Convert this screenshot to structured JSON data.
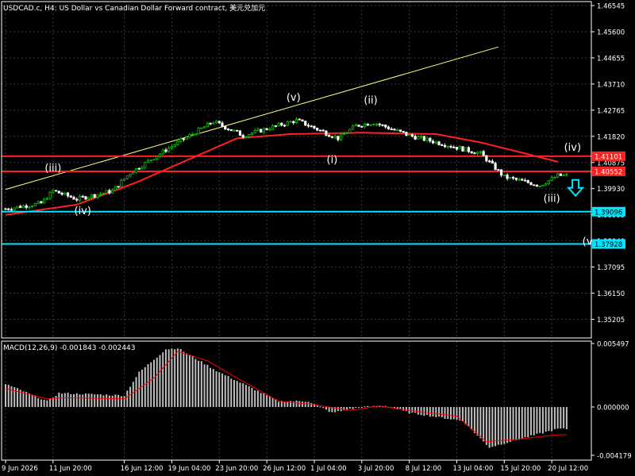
{
  "header": {
    "symbol": "USDCAD.c,",
    "timeframe": "H4:",
    "description": "US Dollar vs Canadian Dollar Forward contract,",
    "description_cn": "美元兑加元"
  },
  "macd": {
    "label": "MACD(12,26,9)",
    "main_value": "-0.001843",
    "signal_value": "-0.002443"
  },
  "colors": {
    "background": "#000000",
    "grid": "#3a3a3a",
    "bull_candle": "#00c800",
    "bear_candle": "#ffffff",
    "moving_average": "#ff2020",
    "trendline": "#ffff80",
    "resistance_line": "#ff2020",
    "support_line": "#00e5ff",
    "price_tag_red": "#ff2020",
    "price_tag_cyan": "#00e5ff",
    "histogram": "#c0c0c0",
    "signal_line": "#ff0000",
    "arrow": "#00e5ff"
  },
  "chart_data": [
    {
      "type": "candlestick",
      "title": "USDCAD.c, H4: US Dollar vs Canadian Dollar Forward contract",
      "y_ticks": [
        "1.46545",
        "1.45600",
        "1.44655",
        "1.43710",
        "1.42765",
        "1.41820",
        "1.40875",
        "1.39930",
        "1.38985",
        "1.38040",
        "1.37095",
        "1.36150",
        "1.35205"
      ],
      "ylim": [
        1.3453,
        1.4669
      ],
      "x_ticks": [
        "9 Jun 2026",
        "11 Jun 20:00",
        "16 Jun 12:00",
        "19 Jun 04:00",
        "23 Jun 20:00",
        "26 Jun 12:00",
        "1 Jul 04:00",
        "3 Jul 20:00",
        "8 Jul 12:00",
        "13 Jul 04:00",
        "15 Jul 20:00",
        "20 Jul 12:00"
      ],
      "x_tick_bars": [
        0,
        16,
        40,
        56,
        72,
        88,
        104,
        120,
        136,
        152,
        168,
        184
      ],
      "bar_count": 190,
      "price_path": [
        [
          0,
          1.392
        ],
        [
          12,
          1.394
        ],
        [
          16,
          1.3985
        ],
        [
          24,
          1.3955
        ],
        [
          36,
          1.3985
        ],
        [
          42,
          1.405
        ],
        [
          55,
          1.414
        ],
        [
          70,
          1.4235
        ],
        [
          80,
          1.4185
        ],
        [
          98,
          1.424
        ],
        [
          112,
          1.4175
        ],
        [
          118,
          1.422
        ],
        [
          124,
          1.4232
        ],
        [
          136,
          1.4185
        ],
        [
          160,
          1.412
        ],
        [
          168,
          1.4035
        ],
        [
          180,
          1.4005
        ],
        [
          186,
          1.404
        ]
      ],
      "moving_average": [
        [
          0,
          1.3898
        ],
        [
          24,
          1.3935
        ],
        [
          44,
          1.4015
        ],
        [
          78,
          1.4175
        ],
        [
          96,
          1.419
        ],
        [
          120,
          1.4195
        ],
        [
          145,
          1.419
        ],
        [
          160,
          1.416
        ],
        [
          175,
          1.412
        ],
        [
          186,
          1.409
        ]
      ],
      "trendline": {
        "from": [
          0,
          1.399
        ],
        "to": [
          166,
          1.4505
        ]
      },
      "horizontal_levels": [
        {
          "price": 1.41101,
          "label": "1.41101",
          "kind": "resistance"
        },
        {
          "price": 1.40552,
          "label": "1.40552",
          "kind": "resistance"
        },
        {
          "price": 1.39096,
          "label": "1.39096",
          "kind": "support"
        },
        {
          "price": 1.37928,
          "label": "1.37928",
          "kind": "support"
        }
      ],
      "wave_labels": [
        {
          "text": "(iii)",
          "bar": 16,
          "price": 1.4055
        },
        {
          "text": "(iv)",
          "bar": 26,
          "price": 1.39
        },
        {
          "text": "(v)",
          "bar": 97,
          "price": 1.431
        },
        {
          "text": "(i)",
          "bar": 110,
          "price": 1.4085
        },
        {
          "text": "(ii)",
          "bar": 123,
          "price": 1.43
        },
        {
          "text": "(iv)",
          "bar": 191,
          "price": 1.413
        },
        {
          "text": "(iii)",
          "bar": 184,
          "price": 1.3945
        },
        {
          "text": "(v",
          "bar": 196,
          "price": 1.379
        }
      ],
      "arrow": {
        "direction": "down",
        "bar": 192,
        "price": 1.399
      }
    },
    {
      "type": "bar",
      "title": "MACD(12,26,9)",
      "y_ticks": [
        "0.005497",
        "0.000000",
        "-0.004179"
      ],
      "ylim": [
        -0.0046,
        0.0057
      ],
      "histogram_path": [
        [
          0,
          0.002
        ],
        [
          14,
          0.0005
        ],
        [
          18,
          0.0012
        ],
        [
          40,
          0.001
        ],
        [
          45,
          0.003
        ],
        [
          54,
          0.005
        ],
        [
          58,
          0.0051
        ],
        [
          72,
          0.003
        ],
        [
          80,
          0.002
        ],
        [
          92,
          0.0005
        ],
        [
          102,
          0.0005
        ],
        [
          110,
          -0.0005
        ],
        [
          120,
          0.0
        ],
        [
          128,
          0.0001
        ],
        [
          136,
          -0.0005
        ],
        [
          154,
          -0.0012
        ],
        [
          163,
          -0.0035
        ],
        [
          170,
          -0.003
        ],
        [
          186,
          -0.0019
        ]
      ],
      "signal_path": [
        [
          0,
          0.0016
        ],
        [
          14,
          0.0007
        ],
        [
          20,
          0.0008
        ],
        [
          40,
          0.0007
        ],
        [
          50,
          0.0025
        ],
        [
          58,
          0.0048
        ],
        [
          68,
          0.004
        ],
        [
          78,
          0.0025
        ],
        [
          92,
          0.0005
        ],
        [
          104,
          0.0002
        ],
        [
          116,
          -0.0003
        ],
        [
          126,
          0.0001
        ],
        [
          136,
          -0.0003
        ],
        [
          152,
          -0.0008
        ],
        [
          162,
          -0.003
        ],
        [
          172,
          -0.0028
        ],
        [
          186,
          -0.0024
        ]
      ]
    }
  ]
}
